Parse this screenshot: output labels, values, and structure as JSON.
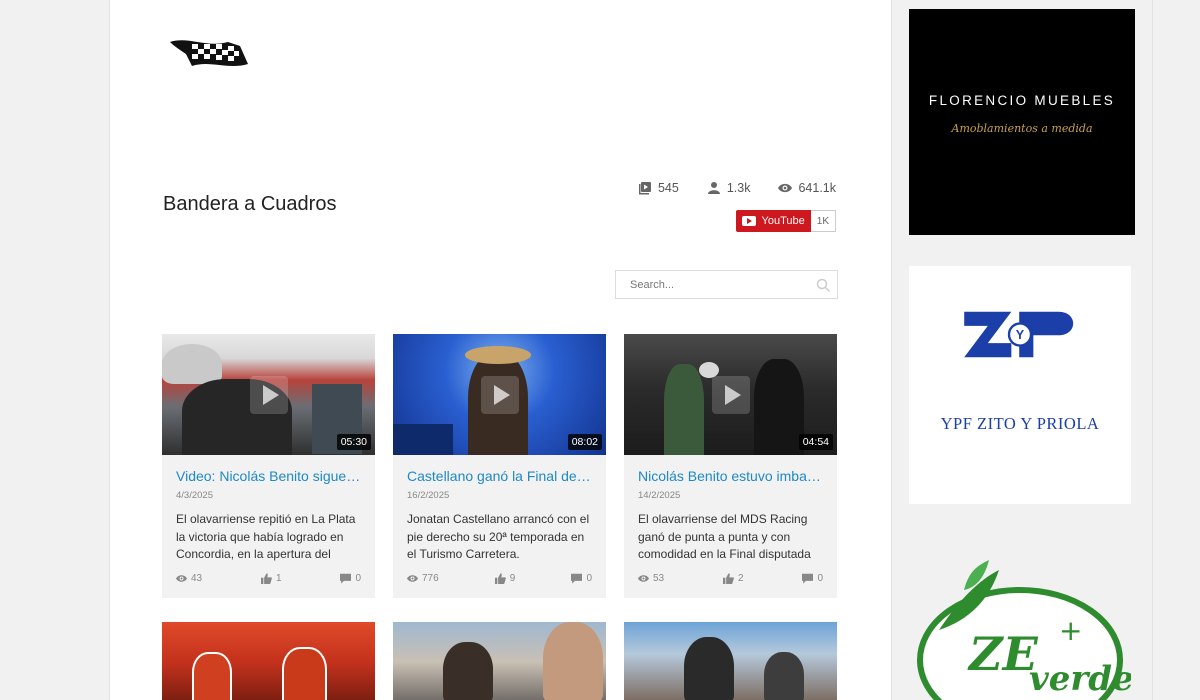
{
  "channel": {
    "title": "Bandera a Cuadros",
    "stats": {
      "videos": "545",
      "subscribers": "1.3k",
      "views": "641.1k"
    },
    "youtube_label": "YouTube",
    "youtube_count": "1K"
  },
  "search": {
    "placeholder": "Search..."
  },
  "videos": [
    {
      "title": "Video: Nicolás Benito sigue …",
      "date": "4/3/2025",
      "description": "El olavarriense repitió en La Plata la victoria que había logrado en Concordia, en la apertura del",
      "duration": "05:30",
      "views": "43",
      "likes": "1",
      "comments": "0"
    },
    {
      "title": "Castellano ganó la Final del…",
      "date": "16/2/2025",
      "description": "Jonatan Castellano arrancó con el pie derecho su 20ª temporada en el Turismo Carretera.",
      "duration": "08:02",
      "views": "776",
      "likes": "9",
      "comments": "0"
    },
    {
      "title": "Nicolás Benito estuvo imba…",
      "date": "14/2/2025",
      "description": "El olavarriense del MDS Racing ganó de punta a punta y con comodidad en la Final disputada",
      "duration": "04:54",
      "views": "53",
      "likes": "2",
      "comments": "0"
    }
  ],
  "ads": {
    "ad1": {
      "brand": "FLORENCIO MUEBLES",
      "tagline": "Amoblamientos a medida"
    },
    "ad2": {
      "brand": "YPF ZITO Y PRIOLA",
      "logo_letters": "ZYP"
    },
    "ad3": {
      "logo_letters": "ZE",
      "word": "verde",
      "plus": "+"
    }
  },
  "colors": {
    "accent_link": "#1e88c8",
    "youtube_red": "#cc181e",
    "ypf_blue": "#1b3ea8",
    "green": "#2e8b2e"
  }
}
